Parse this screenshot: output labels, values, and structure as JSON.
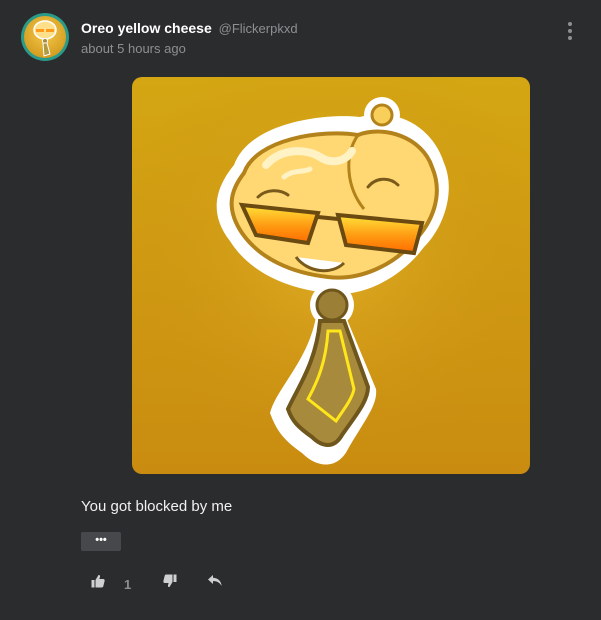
{
  "post": {
    "author": {
      "display_name": "Oreo yellow cheese",
      "handle": "@Flickerpkxd"
    },
    "timestamp": "about 5 hours ago",
    "body_text": "You got blocked by me",
    "more_label": "•••",
    "likes": "1"
  },
  "icons": {
    "options": "kebab-menu-icon",
    "like": "thumbs-up-icon",
    "dislike": "thumbs-down-icon",
    "reply": "reply-icon"
  },
  "colors": {
    "background": "#2b2c2e",
    "accent_gold": "#d4a613",
    "muted_text": "#8e8f92"
  }
}
